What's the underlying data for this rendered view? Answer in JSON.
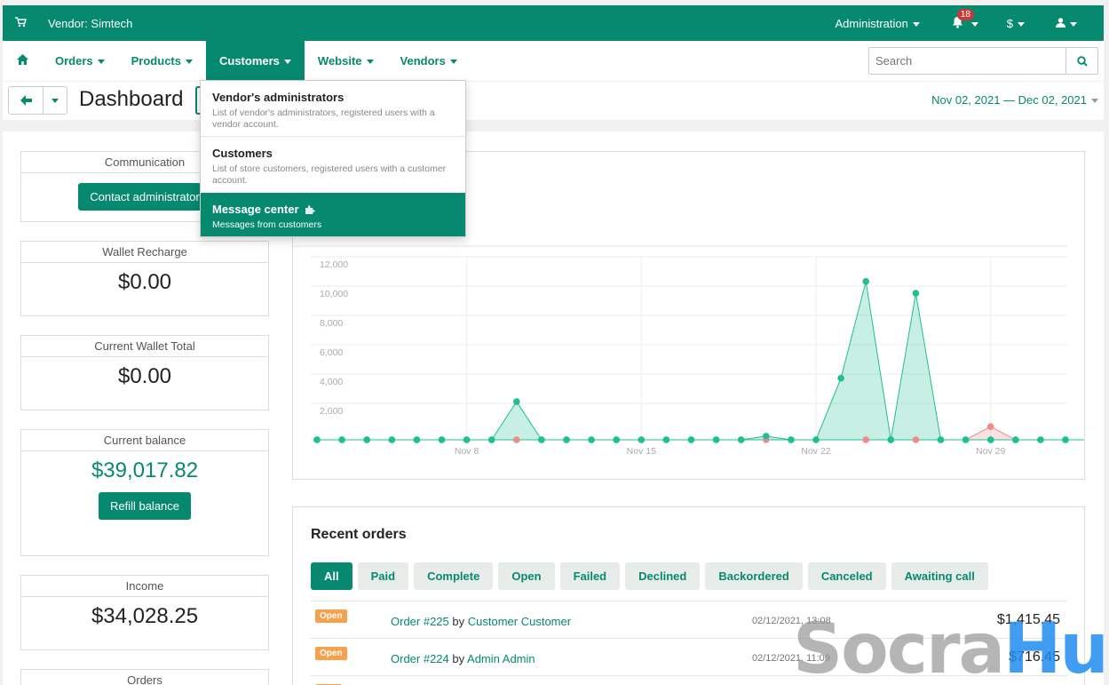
{
  "topbar": {
    "vendor": "Vendor: Simtech",
    "administration": "Administration",
    "notifications": "18",
    "currency": "$"
  },
  "nav": {
    "items": [
      "Orders",
      "Products",
      "Customers",
      "Website",
      "Vendors"
    ],
    "search_placeholder": "Search"
  },
  "dropdown": {
    "items": [
      {
        "title": "Vendor's administrators",
        "desc": "List of vendor's administrators, registered users with a vendor account."
      },
      {
        "title": "Customers",
        "desc": "List of store customers, registered users with a customer account."
      },
      {
        "title": "Message center",
        "desc": "Messages from customers"
      }
    ]
  },
  "title": {
    "page": "Dashboard",
    "date_range": "Nov 02, 2021 — Dec 02, 2021"
  },
  "cards": {
    "communication": {
      "label": "Communication",
      "button": "Contact administrator"
    },
    "wallet_recharge": {
      "label": "Wallet Recharge",
      "value": "$0.00"
    },
    "wallet_total": {
      "label": "Current Wallet Total",
      "value": "$0.00"
    },
    "balance": {
      "label": "Current balance",
      "value": "$39,017.82",
      "button": "Refill balance"
    },
    "income": {
      "label": "Income",
      "value": "$34,028.25"
    },
    "orders": {
      "label": "Orders"
    }
  },
  "chart_data": {
    "type": "area",
    "yticks": [
      "12,000",
      "10,000",
      "8,000",
      "6,000",
      "4,000",
      "2,000"
    ],
    "ylim": [
      0,
      12000
    ],
    "xticks": [
      {
        "label": "Nov 8",
        "index": 6
      },
      {
        "label": "Nov 15",
        "index": 13
      },
      {
        "label": "Nov 22",
        "index": 20
      },
      {
        "label": "Nov 29",
        "index": 27
      }
    ],
    "series": [
      {
        "color": "#1ec08e",
        "values": [
          0,
          0,
          0,
          0,
          0,
          0,
          0,
          0,
          2600,
          0,
          0,
          0,
          0,
          0,
          0,
          0,
          0,
          0,
          250,
          0,
          0,
          4200,
          10800,
          0,
          10000,
          0,
          0,
          0,
          0,
          0,
          0,
          0
        ]
      },
      {
        "color": "#f08a8a",
        "values": [
          0,
          0,
          0,
          0,
          0,
          0,
          0,
          0,
          0,
          0,
          0,
          0,
          0,
          0,
          0,
          0,
          0,
          0,
          0,
          0,
          0,
          0,
          0,
          0,
          0,
          0,
          0,
          900,
          0,
          0,
          0,
          0
        ]
      }
    ]
  },
  "recent_orders": {
    "title": "Recent orders",
    "tabs": [
      "All",
      "Paid",
      "Complete",
      "Open",
      "Failed",
      "Declined",
      "Backordered",
      "Canceled",
      "Awaiting call"
    ],
    "rows": [
      {
        "status": "Open",
        "order": "Order #225",
        "by": "by",
        "customer": "Customer Customer",
        "date": "02/12/2021, 13:08",
        "amount": "$1,415.45"
      },
      {
        "status": "Open",
        "order": "Order #224",
        "by": "by",
        "customer": "Admin Admin",
        "date": "02/12/2021, 11:09",
        "amount": "$716.45"
      }
    ]
  },
  "watermark": {
    "a": "Socra",
    "b": "Hub"
  }
}
